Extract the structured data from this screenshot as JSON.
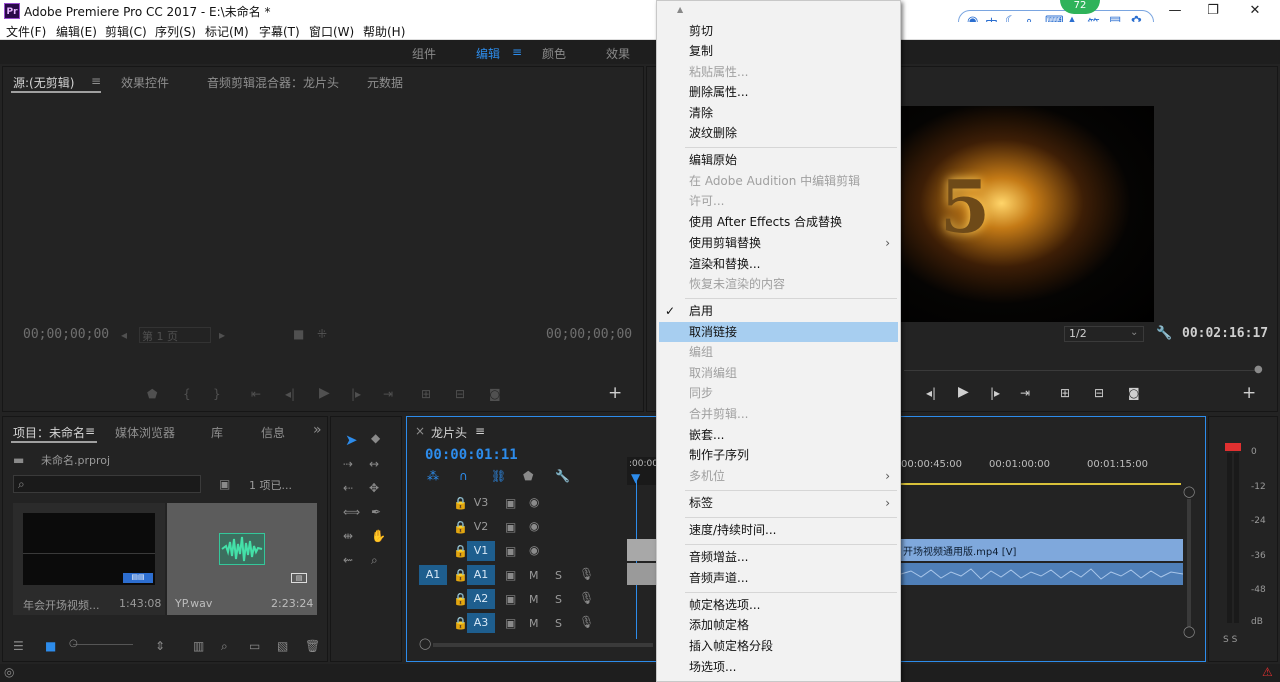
{
  "app": {
    "title": "Adobe Premiere Pro CC 2017 - E:\\未命名 *",
    "logo": "Pr",
    "colors": {
      "accent": "#2d8ceb",
      "menu_highlight": "#a7cef0",
      "audio_meter_peak": "#e03030"
    }
  },
  "window_controls": {
    "minimize": "—",
    "maximize": "❐",
    "close": "✕"
  },
  "tray": {
    "badge": "72",
    "items": [
      "中",
      "☾",
      "∘",
      "⌨",
      "▲",
      "简",
      "▤",
      "✿"
    ]
  },
  "menubar": [
    "文件(F)",
    "编辑(E)",
    "剪辑(C)",
    "序列(S)",
    "标记(M)",
    "字幕(T)",
    "窗口(W)",
    "帮助(H)"
  ],
  "workspaces": {
    "items": [
      "组件",
      "编辑",
      "颜色",
      "效果"
    ],
    "active": "编辑",
    "menu_icon": "≡"
  },
  "source_panel": {
    "tabs": [
      "源:(无剪辑)",
      "效果控件",
      "音频剪辑混合器：龙片头",
      "元数据"
    ],
    "tab_menu": "≡",
    "timecode_left": "00;00;00;00",
    "timecode_right": "00;00;00;00",
    "page_select": "第 1 页"
  },
  "program_panel": {
    "zoom": "1/2",
    "duration": "00:02:16:17",
    "video_glyph": "5"
  },
  "context_menu": {
    "top_arrow": "▲",
    "items": [
      {
        "label": "剪切",
        "disabled": false
      },
      {
        "label": "复制",
        "disabled": false
      },
      {
        "label": "粘贴属性...",
        "disabled": true
      },
      {
        "label": "删除属性...",
        "disabled": false
      },
      {
        "label": "清除",
        "disabled": false
      },
      {
        "label": "波纹删除",
        "disabled": false
      },
      {
        "label": "编辑原始",
        "disabled": false
      },
      {
        "label": "在 Adobe Audition 中编辑剪辑",
        "disabled": true
      },
      {
        "label": "许可...",
        "disabled": true
      },
      {
        "label": "使用 After Effects 合成替换",
        "disabled": false
      },
      {
        "label": "使用剪辑替换",
        "disabled": false,
        "submenu": true
      },
      {
        "label": "渲染和替换...",
        "disabled": false
      },
      {
        "label": "恢复未渲染的内容",
        "disabled": true
      },
      {
        "label": "启用",
        "disabled": false,
        "checked": true
      },
      {
        "label": "取消链接",
        "disabled": false,
        "highlighted": true
      },
      {
        "label": "编组",
        "disabled": true
      },
      {
        "label": "取消编组",
        "disabled": true
      },
      {
        "label": "同步",
        "disabled": true
      },
      {
        "label": "合并剪辑...",
        "disabled": true
      },
      {
        "label": "嵌套...",
        "disabled": false
      },
      {
        "label": "制作子序列",
        "disabled": false
      },
      {
        "label": "多机位",
        "disabled": true,
        "submenu": true
      },
      {
        "label": "标签",
        "disabled": false,
        "submenu": true
      },
      {
        "label": "速度/持续时间...",
        "disabled": false
      },
      {
        "label": "音频增益...",
        "disabled": false
      },
      {
        "label": "音频声道...",
        "disabled": false
      },
      {
        "label": "帧定格选项...",
        "disabled": false
      },
      {
        "label": "添加帧定格",
        "disabled": false
      },
      {
        "label": "插入帧定格分段",
        "disabled": false
      },
      {
        "label": "场选项...",
        "disabled": false
      }
    ],
    "check_glyph": "✓",
    "submenu_glyph": "›"
  },
  "project_panel": {
    "tabs": [
      "项目：未命名",
      "媒体浏览器",
      "库",
      "信息"
    ],
    "tab_menu": "≡",
    "more": "»",
    "file": "未命名.prproj",
    "items_count": "1 项已...",
    "clips": [
      {
        "name": "年会开场视频...",
        "duration": "1:43:08"
      },
      {
        "name": "YP.wav",
        "duration": "2:23:24"
      }
    ]
  },
  "timeline": {
    "tab": "龙片头",
    "tab_menu": "≡",
    "close": "×",
    "timecode": "00:00:01:11",
    "ruler": [
      ":00:00",
      "00:00:45:00",
      "00:01:00:00",
      "00:01:15:00"
    ],
    "video_tracks": [
      "V3",
      "V2",
      "V1"
    ],
    "audio_tracks": [
      "A1",
      "A2",
      "A3"
    ],
    "source_patch_audio": "A1",
    "track_flag_m": "M",
    "track_flag_s": "S",
    "clip_label": "开场视频通用版.mp4 [V]"
  },
  "audio_meter": {
    "scale": [
      "0",
      "-12",
      "-24",
      "-36",
      "-48",
      "dB"
    ],
    "peak_marks": "S S"
  }
}
